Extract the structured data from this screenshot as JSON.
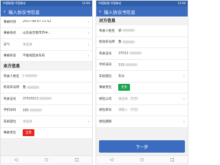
{
  "left": {
    "status": {
      "left": "中国联通 中国移动",
      "right": "14:06"
    },
    "app_title": "输入协议书信息",
    "rows_top": [
      {
        "label": "事故时间",
        "value": "2017-08-07 11:52",
        "placeholder": false
      },
      {
        "label": "事故地点",
        "value": "山东省济南市市中...",
        "placeholder": false
      },
      {
        "label": "天气",
        "value": "请选择",
        "placeholder": true
      },
      {
        "label": "事故形态",
        "value": "不能规定驶车的",
        "placeholder": false
      }
    ],
    "section": "本方信息",
    "rows_bottom": [
      {
        "label": "驾驶人姓名",
        "value": "|"
      },
      {
        "label": "机动车号牌",
        "value": "鲁"
      },
      {
        "label": "驾驶证号",
        "value": "37010211"
      },
      {
        "label": "手机号码",
        "value": "185"
      },
      {
        "label": "车损部位",
        "value": "请选择"
      },
      {
        "label": "事故责任",
        "value": "全责"
      }
    ]
  },
  "right": {
    "status": {
      "left": "中国联通 中国移动",
      "right": "14:06"
    },
    "app_title": "输入协议书信息",
    "section": "对方信息",
    "rows": [
      {
        "label": "驾驶人姓名",
        "value": "郭"
      },
      {
        "label": "机动车号牌",
        "value": "鲁"
      },
      {
        "label": "驾驶证号",
        "value": "37012"
      },
      {
        "label": "手机号码",
        "value": "133"
      },
      {
        "label": "车损部位",
        "value": "车头"
      },
      {
        "label": "事故责任",
        "value": "无责"
      },
      {
        "label": "保险公司",
        "value": "请选择（可空）"
      },
      {
        "label": "保险单号",
        "value": "请输入（可空）"
      },
      {
        "label": "保险期限",
        "value": ""
      }
    ],
    "next_button": "下一步"
  },
  "nav_icons": [
    "back-triangle-icon",
    "home-circle-icon",
    "recent-square-icon"
  ],
  "colors": {
    "appbar": "#3b6cc0",
    "red_chip": "#e8251f",
    "green_chip": "#1aa34a"
  }
}
